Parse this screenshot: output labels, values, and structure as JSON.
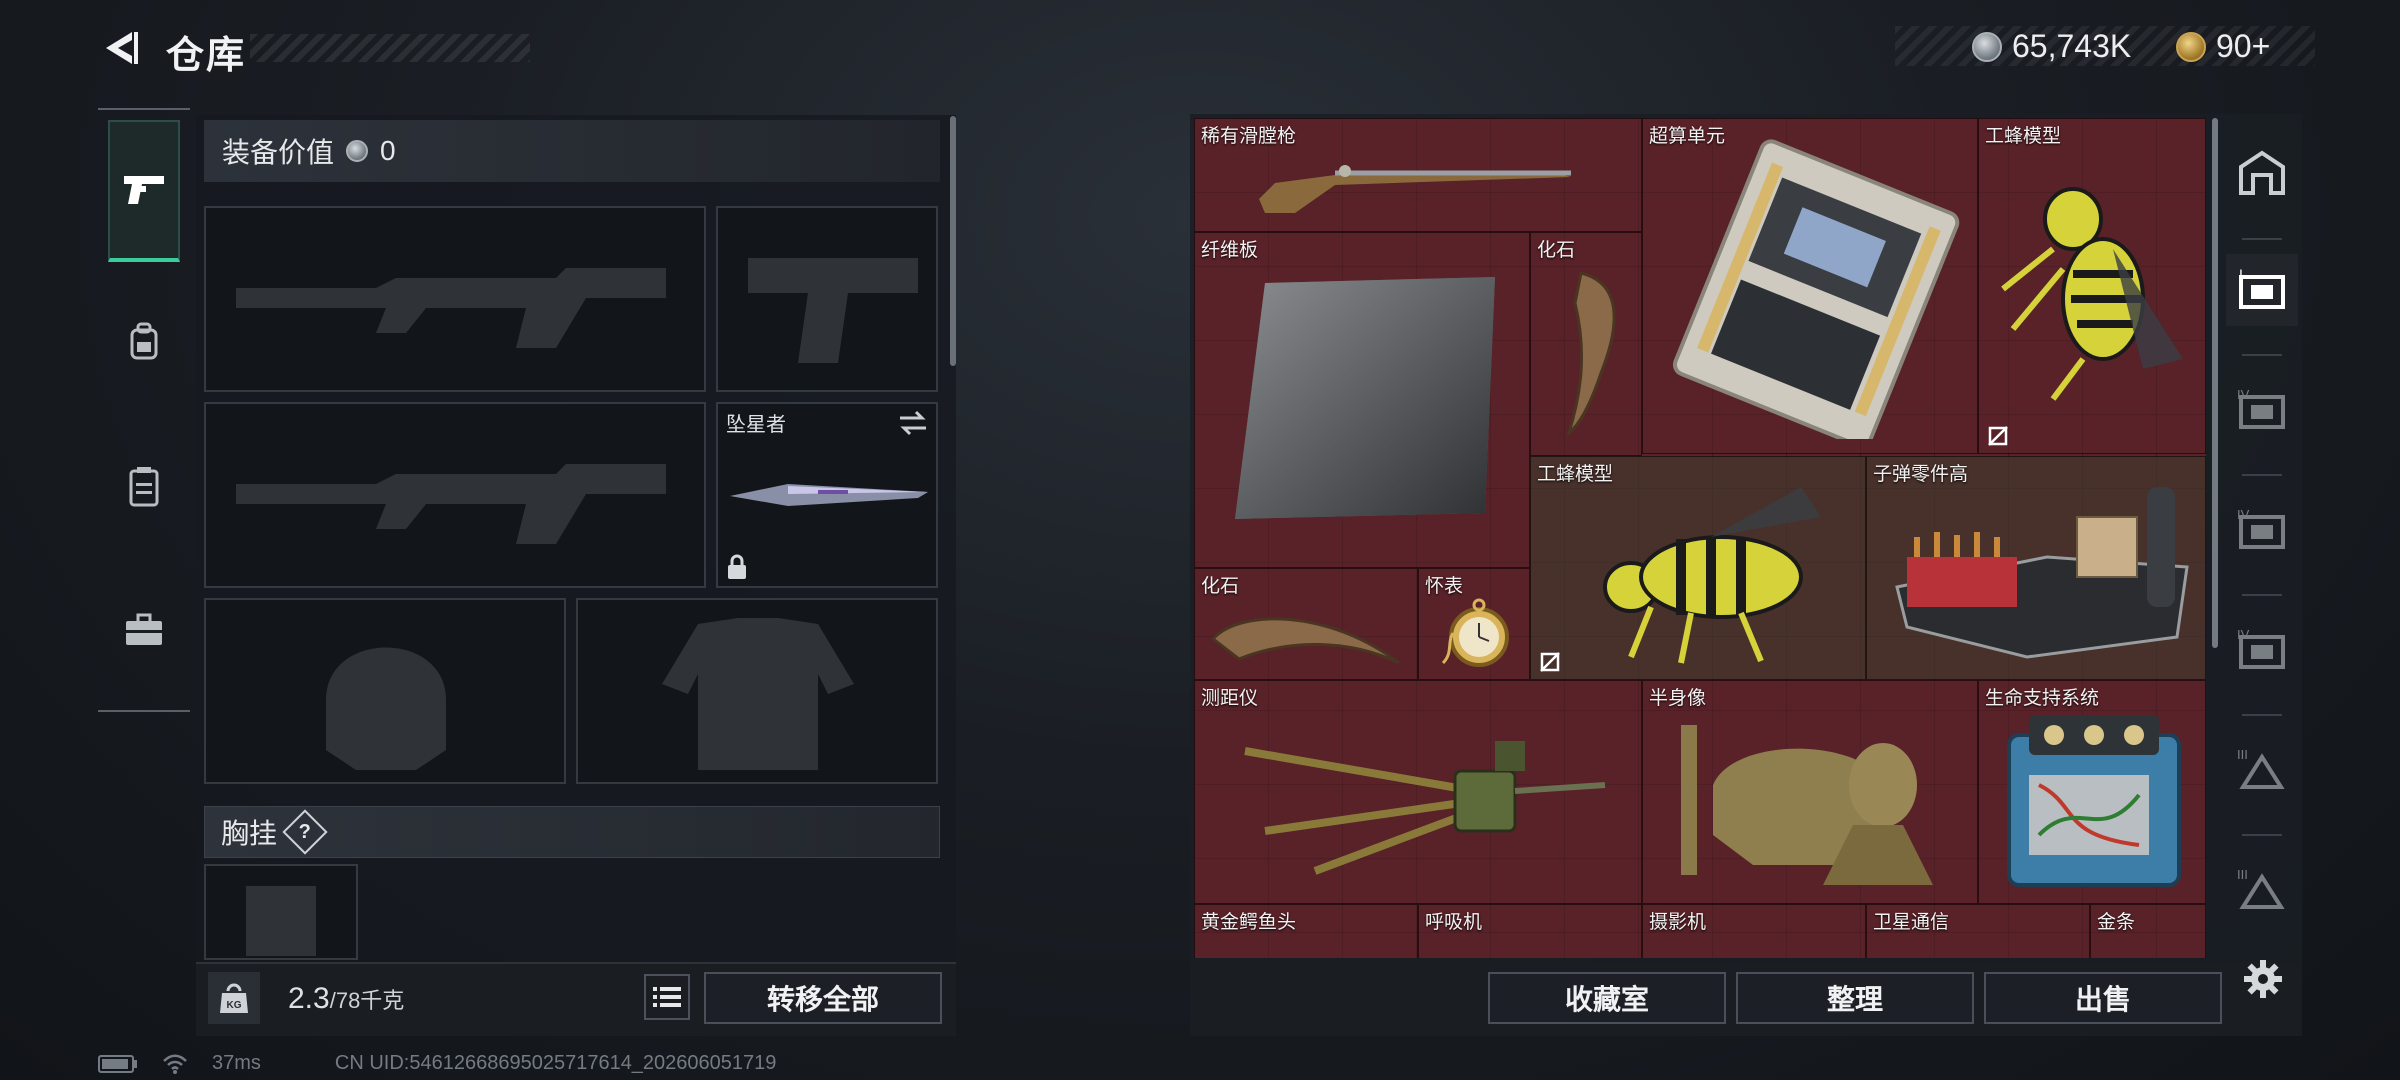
{
  "header": {
    "title": "仓库",
    "silver_amount": "65,743K",
    "gold_amount": "90+"
  },
  "equipment": {
    "value_label": "装备价值",
    "value": "0",
    "melee_slot_label": "坠星者",
    "chest_label": "胸挂",
    "chest_hint": "?"
  },
  "bottom_left": {
    "weight_current": "2.3",
    "weight_max": "/78千克",
    "transfer_all": "转移全部"
  },
  "storage": {
    "items": [
      {
        "label": "稀有滑膛枪"
      },
      {
        "label": "超算单元"
      },
      {
        "label": "工蜂模型"
      },
      {
        "label": "纤维板"
      },
      {
        "label": "化石"
      },
      {
        "label": "工蜂模型"
      },
      {
        "label": "子弹零件高"
      },
      {
        "label": "化石"
      },
      {
        "label": "怀表"
      },
      {
        "label": "测距仪"
      },
      {
        "label": "半身像"
      },
      {
        "label": "生命支持系统"
      },
      {
        "label": "黄金鳄鱼头"
      },
      {
        "label": "呼吸机"
      },
      {
        "label": "摄影机"
      },
      {
        "label": "卫星通信"
      },
      {
        "label": "金条"
      }
    ],
    "right_tabs": [
      "roof-icon",
      "storage-I-icon",
      "storage-IV-icon",
      "storage-IV-icon",
      "storage-IV-icon",
      "storage-III-icon",
      "storage-III-icon"
    ]
  },
  "bottom_right": {
    "collection": "收藏室",
    "organize": "整理",
    "sell": "出售"
  },
  "status": {
    "ping": "37ms",
    "uid": "CN UID:546126686950257176­14_202606051719"
  },
  "colors": {
    "accent": "#3ccc9a",
    "grid_red": "#5a2229",
    "grid_brown": "#42342c"
  }
}
